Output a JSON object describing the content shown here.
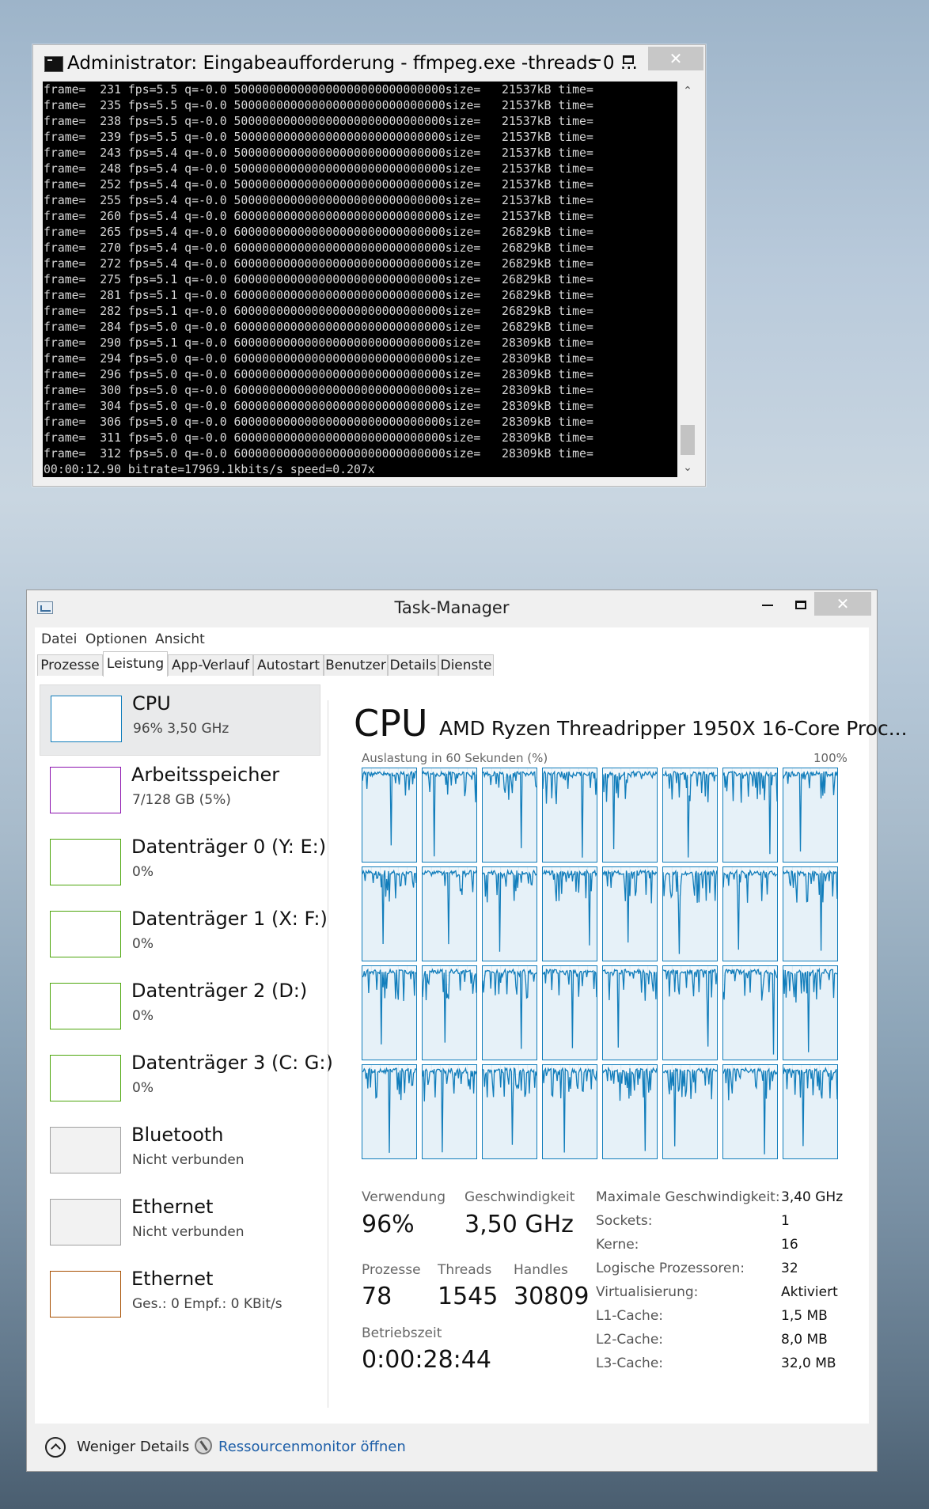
{
  "cmd_window": {
    "title": "Administrator: Eingabeaufforderung - ffmpeg.exe  -threads 0 ...",
    "minimize": "—",
    "close": "✕",
    "lines": [
      "frame=  231 fps=5.5 q=-0.0 500000000000000000000000000000size=   21537kB time=",
      "frame=  235 fps=5.5 q=-0.0 500000000000000000000000000000size=   21537kB time=",
      "frame=  238 fps=5.5 q=-0.0 500000000000000000000000000000size=   21537kB time=",
      "frame=  239 fps=5.5 q=-0.0 500000000000000000000000000000size=   21537kB time=",
      "frame=  243 fps=5.4 q=-0.0 500000000000000000000000000000size=   21537kB time=",
      "frame=  248 fps=5.4 q=-0.0 500000000000000000000000000000size=   21537kB time=",
      "frame=  252 fps=5.4 q=-0.0 500000000000000000000000000000size=   21537kB time=",
      "frame=  255 fps=5.4 q=-0.0 500000000000000000000000000000size=   21537kB time=",
      "frame=  260 fps=5.4 q=-0.0 600000000000000000000000000000size=   21537kB time=",
      "frame=  265 fps=5.4 q=-0.0 600000000000000000000000000000size=   26829kB time=",
      "frame=  270 fps=5.4 q=-0.0 600000000000000000000000000000size=   26829kB time=",
      "frame=  272 fps=5.4 q=-0.0 600000000000000000000000000000size=   26829kB time=",
      "frame=  275 fps=5.1 q=-0.0 600000000000000000000000000000size=   26829kB time=",
      "frame=  281 fps=5.1 q=-0.0 600000000000000000000000000000size=   26829kB time=",
      "frame=  282 fps=5.1 q=-0.0 600000000000000000000000000000size=   26829kB time=",
      "frame=  284 fps=5.0 q=-0.0 600000000000000000000000000000size=   26829kB time=",
      "frame=  290 fps=5.1 q=-0.0 600000000000000000000000000000size=   28309kB time=",
      "frame=  294 fps=5.0 q=-0.0 600000000000000000000000000000size=   28309kB time=",
      "frame=  296 fps=5.0 q=-0.0 600000000000000000000000000000size=   28309kB time=",
      "frame=  300 fps=5.0 q=-0.0 600000000000000000000000000000size=   28309kB time=",
      "frame=  304 fps=5.0 q=-0.0 600000000000000000000000000000size=   28309kB time=",
      "frame=  306 fps=5.0 q=-0.0 600000000000000000000000000000size=   28309kB time=",
      "frame=  311 fps=5.0 q=-0.0 600000000000000000000000000000size=   28309kB time=",
      "frame=  312 fps=5.0 q=-0.0 600000000000000000000000000000size=   28309kB time=",
      "00:00:12.90 bitrate=17969.1kbits/s speed=0.207x"
    ],
    "scroll_up": "⌃",
    "scroll_down": "⌄"
  },
  "taskmanager": {
    "title": "Task-Manager",
    "minimize": "—",
    "close": "✕",
    "menu": [
      "Datei",
      "Optionen",
      "Ansicht"
    ],
    "tabs": [
      "Prozesse",
      "Leistung",
      "App-Verlauf",
      "Autostart",
      "Benutzer",
      "Details",
      "Dienste"
    ],
    "active_tab": "Leistung",
    "sidebar": [
      {
        "title": "CPU",
        "sub": "96%  3,50 GHz",
        "color": "#117dbb",
        "selected": true
      },
      {
        "title": "Arbeitsspeicher",
        "sub": "7/128 GB (5%)",
        "color": "#8b12ae"
      },
      {
        "title": "Datenträger 0 (Y: E:)",
        "sub": "0%",
        "color": "#4da60c"
      },
      {
        "title": "Datenträger 1 (X: F:)",
        "sub": "0%",
        "color": "#4da60c"
      },
      {
        "title": "Datenträger 2 (D:)",
        "sub": "0%",
        "color": "#4da60c"
      },
      {
        "title": "Datenträger 3 (C: G:)",
        "sub": "0%",
        "color": "#4da60c"
      },
      {
        "title": "Bluetooth",
        "sub": "Nicht verbunden",
        "color": "#a0a0a0"
      },
      {
        "title": "Ethernet",
        "sub": "Nicht verbunden",
        "color": "#a0a0a0"
      },
      {
        "title": "Ethernet",
        "sub": "Ges.: 0  Empf.: 0 KBit/s",
        "color": "#a74f01"
      }
    ],
    "cpu_heading": "CPU",
    "cpu_model": "AMD Ryzen Threadripper 1950X 16-Core Proc...",
    "util_label": "Auslastung in 60 Sekunden (%)",
    "util_max": "100%",
    "logical_processor_count": 32,
    "stats": {
      "verwendung_label": "Verwendung",
      "verwendung": "96%",
      "geschw_label": "Geschwindigkeit",
      "geschw": "3,50 GHz",
      "prozesse_label": "Prozesse",
      "prozesse": "78",
      "threads_label": "Threads",
      "threads": "1545",
      "handles_label": "Handles",
      "handles": "30809",
      "betrieb_label": "Betriebszeit",
      "betrieb": "0:00:28:44"
    },
    "info": [
      {
        "label": "Maximale Geschwindigkeit:",
        "value": "3,40 GHz"
      },
      {
        "label": "Sockets:",
        "value": "1"
      },
      {
        "label": "Kerne:",
        "value": "16"
      },
      {
        "label": "Logische Prozessoren:",
        "value": "32"
      },
      {
        "label": "Virtualisierung:",
        "value": "Aktiviert"
      },
      {
        "label": "L1-Cache:",
        "value": "1,5 MB"
      },
      {
        "label": "L2-Cache:",
        "value": "8,0 MB"
      },
      {
        "label": "L3-Cache:",
        "value": "32,0 MB"
      }
    ],
    "footer": {
      "fewer_details": "Weniger Details",
      "resmon": "Ressourcenmonitor öffnen"
    },
    "accent": "#117dbb"
  }
}
